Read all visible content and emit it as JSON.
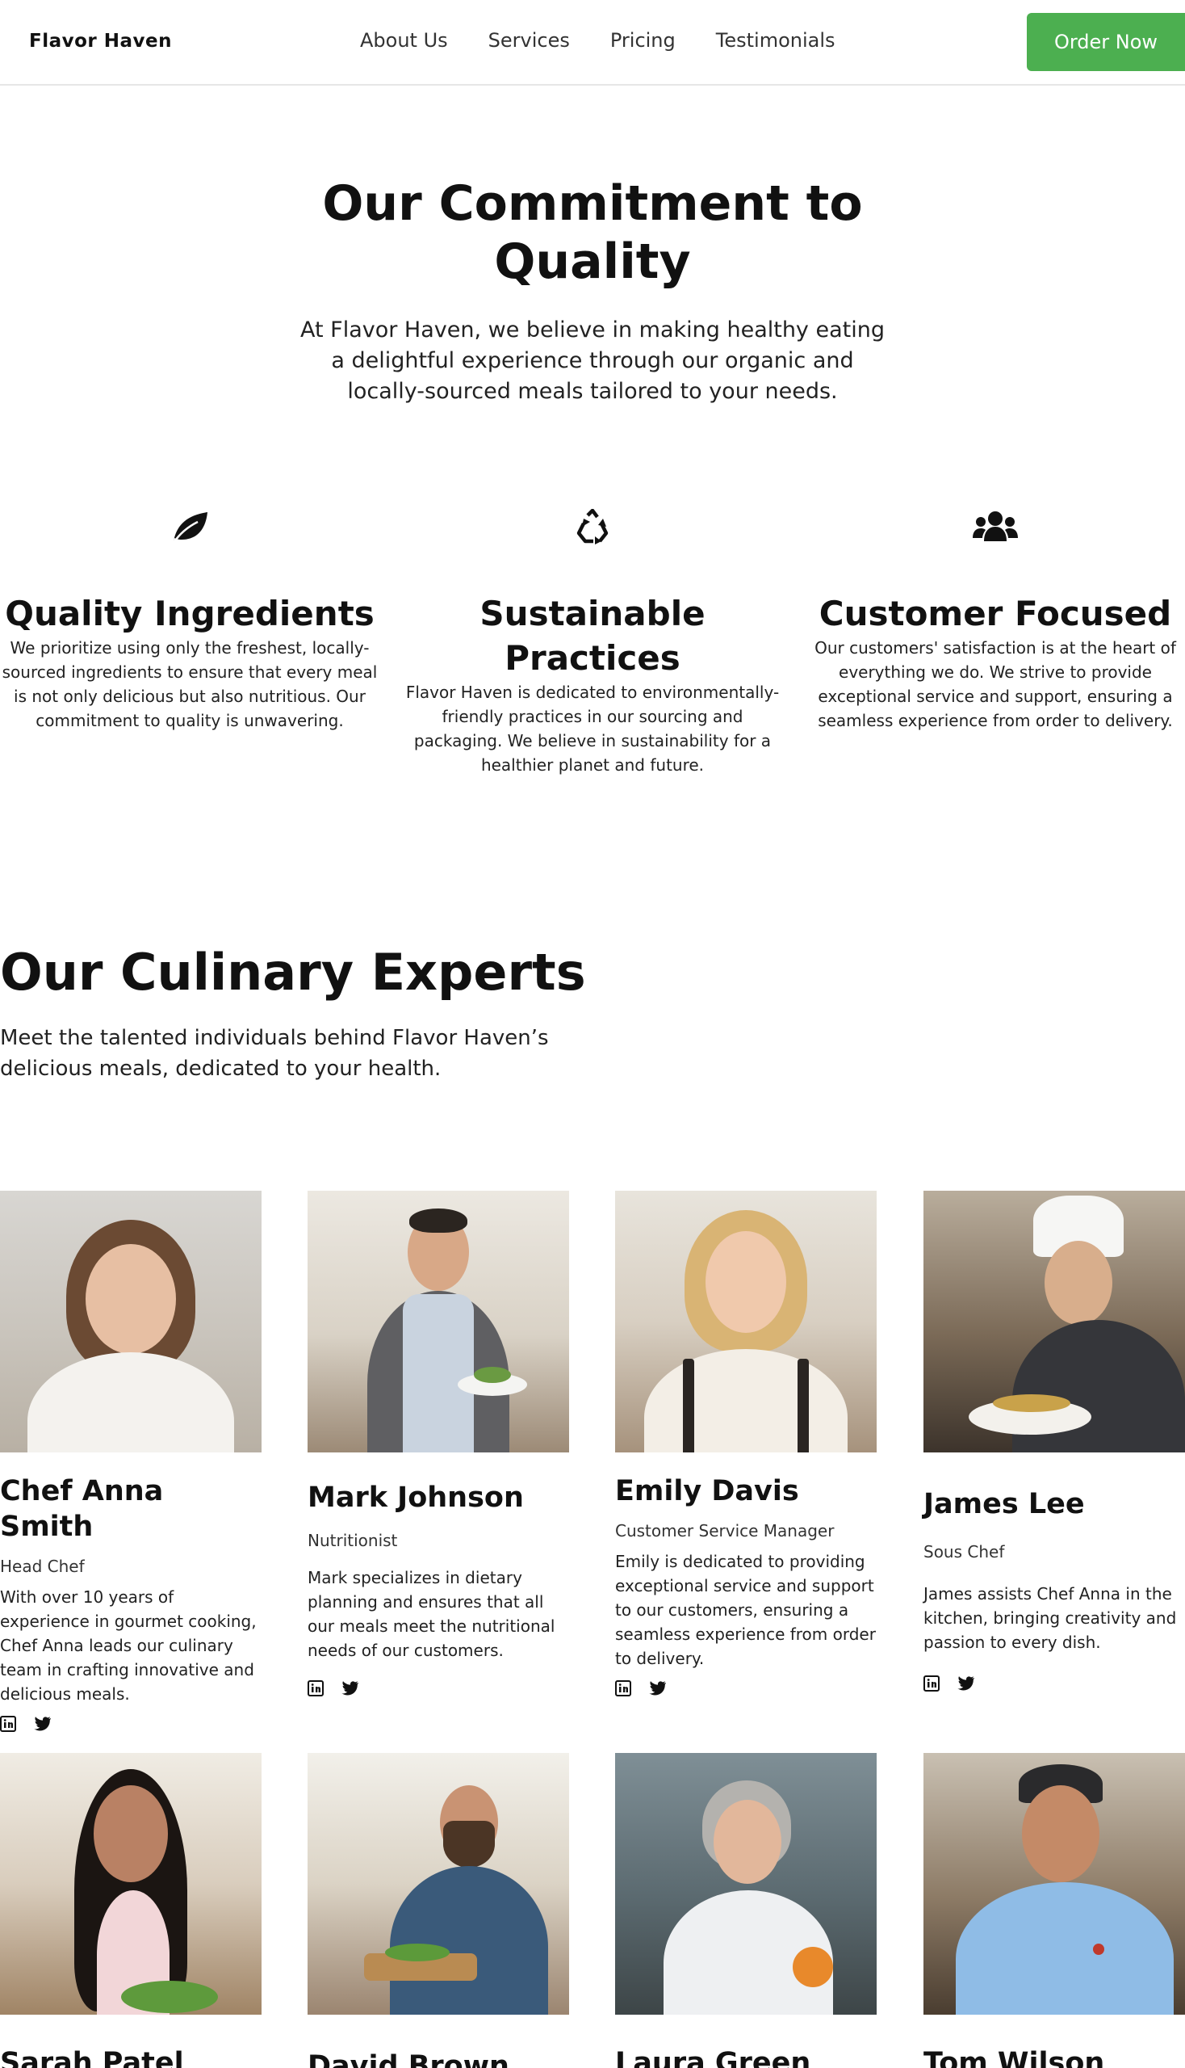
{
  "header": {
    "logo": "Flavor Haven",
    "nav": [
      "About Us",
      "Services",
      "Pricing",
      "Testimonials"
    ],
    "cta": "Order Now"
  },
  "commitment": {
    "title": "Our Commitment to Quality",
    "subtitle": "At Flavor Haven, we believe in making healthy eating a delightful experience through our organic and locally-sourced meals tailored to your needs.",
    "features": [
      {
        "icon": "leaf-icon",
        "title": "Quality Ingredients",
        "text": "We prioritize using only the freshest, locally-sourced ingredients to ensure that every meal is not only delicious but also nutritious. Our commitment to quality is unwavering."
      },
      {
        "icon": "recycle-icon",
        "title": "Sustainable Practices",
        "text": "Flavor Haven is dedicated to environmentally-friendly practices in our sourcing and packaging. We believe in sustainability for a healthier planet and future."
      },
      {
        "icon": "users-icon",
        "title": "Customer Focused",
        "text": "Our customers' satisfaction is at the heart of everything we do. We strive to provide exceptional service and support, ensuring a seamless experience from order to delivery."
      }
    ]
  },
  "experts": {
    "title": "Our Culinary Experts",
    "subtitle": "Meet the talented individuals behind Flavor Haven’s delicious meals, dedicated to your health.",
    "members": [
      {
        "name": "Chef Anna Smith",
        "role": "Head Chef",
        "bio": "With over 10 years of experience in gourmet cooking, Chef Anna leads our culinary team in crafting innovative and delicious meals."
      },
      {
        "name": "Mark Johnson",
        "role": "Nutritionist",
        "bio": "Mark specializes in dietary planning and ensures that all our meals meet the nutritional needs of our customers."
      },
      {
        "name": "Emily Davis",
        "role": "Customer Service Manager",
        "bio": "Emily is dedicated to providing exceptional service and support to our customers, ensuring a seamless experience from order to delivery."
      },
      {
        "name": "James Lee",
        "role": "Sous Chef",
        "bio": "James assists Chef Anna in the kitchen, bringing creativity and passion to every dish."
      },
      {
        "name": "Sarah Patel"
      },
      {
        "name": "David Brown"
      },
      {
        "name": "Laura Green"
      },
      {
        "name": "Tom Wilson"
      }
    ]
  },
  "colors": {
    "accent": "#4caf50",
    "text": "#111111",
    "border": "#e6e6e6"
  }
}
